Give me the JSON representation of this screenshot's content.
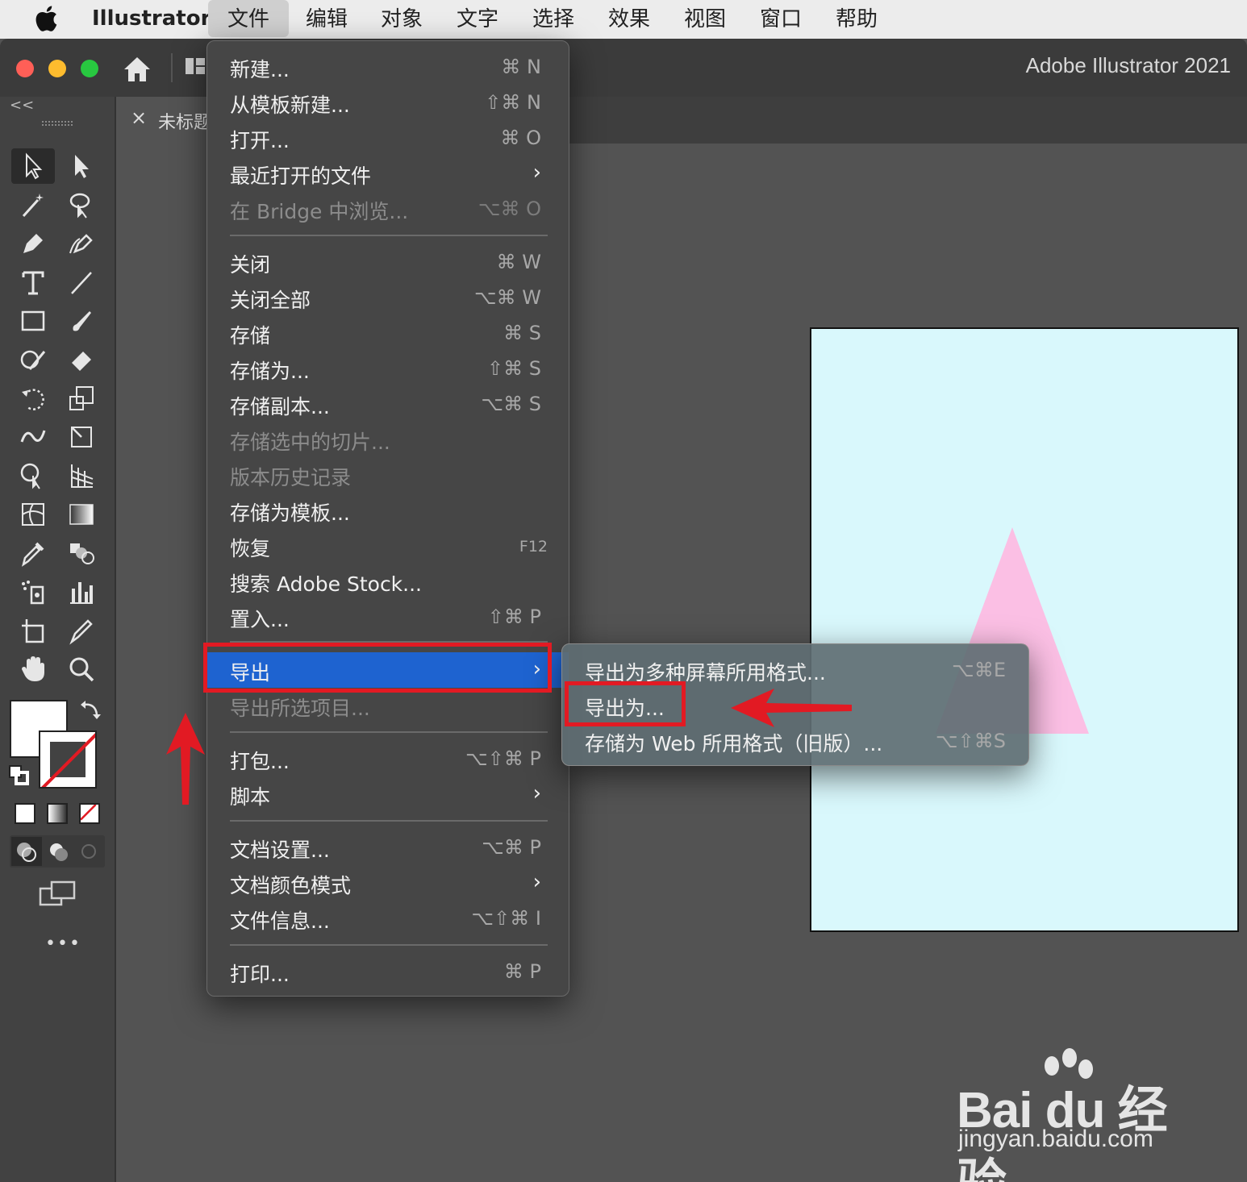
{
  "menubar": {
    "app_name": "Illustrator",
    "items": [
      "文件",
      "编辑",
      "对象",
      "文字",
      "选择",
      "效果",
      "视图",
      "窗口",
      "帮助"
    ]
  },
  "window": {
    "title": "Adobe Illustrator 2021",
    "tab_close": "×",
    "tab_name": "未标题"
  },
  "toolbar": {
    "collapse": "<<",
    "more": "•••"
  },
  "file_menu": {
    "items": [
      {
        "label": "新建...",
        "shortcut": "⌘ N"
      },
      {
        "label": "从模板新建...",
        "shortcut": "⇧⌘ N"
      },
      {
        "label": "打开...",
        "shortcut": "⌘ O"
      },
      {
        "label": "最近打开的文件",
        "shortcut": "›"
      },
      {
        "label": "在 Bridge 中浏览...",
        "shortcut": "⌥⌘ O"
      },
      {
        "label": "关闭",
        "shortcut": "⌘ W"
      },
      {
        "label": "关闭全部",
        "shortcut": "⌥⌘ W"
      },
      {
        "label": "存储",
        "shortcut": "⌘ S"
      },
      {
        "label": "存储为...",
        "shortcut": "⇧⌘ S"
      },
      {
        "label": "存储副本...",
        "shortcut": "⌥⌘ S"
      },
      {
        "label": "存储选中的切片...",
        "shortcut": ""
      },
      {
        "label": "版本历史记录",
        "shortcut": ""
      },
      {
        "label": "存储为模板...",
        "shortcut": ""
      },
      {
        "label": "恢复",
        "shortcut": "F12"
      },
      {
        "label": "搜索 Adobe Stock...",
        "shortcut": ""
      },
      {
        "label": "置入...",
        "shortcut": "⇧⌘ P"
      },
      {
        "label": "导出",
        "shortcut": "›"
      },
      {
        "label": "导出所选项目...",
        "shortcut": ""
      },
      {
        "label": "打包...",
        "shortcut": "⌥⇧⌘ P"
      },
      {
        "label": "脚本",
        "shortcut": "›"
      },
      {
        "label": "文档设置...",
        "shortcut": "⌥⌘ P"
      },
      {
        "label": "文档颜色模式",
        "shortcut": "›"
      },
      {
        "label": "文件信息...",
        "shortcut": "⌥⇧⌘ I"
      },
      {
        "label": "打印...",
        "shortcut": "⌘ P"
      }
    ]
  },
  "export_submenu": {
    "items": [
      {
        "label": "导出为多种屏幕所用格式...",
        "shortcut": "⌥⌘E"
      },
      {
        "label": "导出为...",
        "shortcut": ""
      },
      {
        "label": "存储为 Web 所用格式（旧版）...",
        "shortcut": "⌥⇧⌘S"
      }
    ]
  },
  "watermark": {
    "logo": "Bai du 经验",
    "url": "jingyan.baidu.com"
  },
  "colors": {
    "highlight": "#1e63d0",
    "annotation": "#e21a23",
    "artboard": "#d9f8fc",
    "triangle": "#fbbfe4"
  }
}
